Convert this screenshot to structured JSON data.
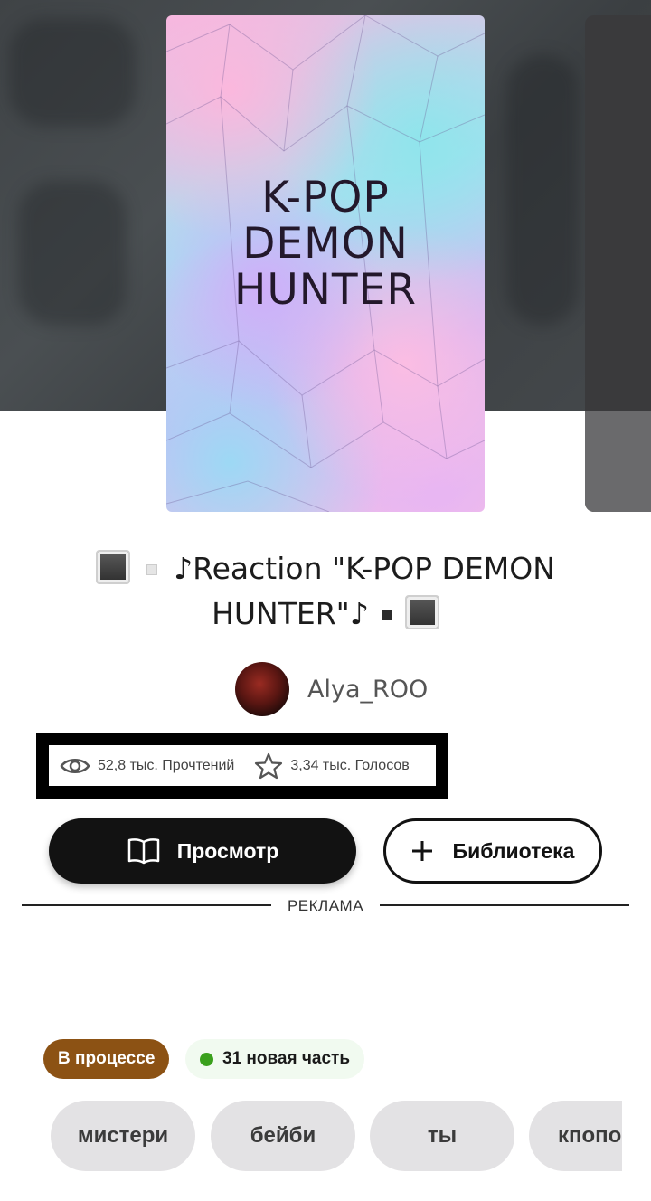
{
  "story": {
    "cover_text": [
      "K-POP",
      "DEMON",
      "HUNTER"
    ],
    "title_line1": "♪Reaction \"K-POP DEMON",
    "title_line2": "HUNTER\"♪"
  },
  "author": {
    "name": "Alya_ROO"
  },
  "stats": {
    "reads": "52,8 тыс. Прочтений",
    "votes": "3,34 тыс. Голосов"
  },
  "actions": {
    "read_label": "Просмотр",
    "library_label": "Библиотека"
  },
  "ad": {
    "label": "РЕКЛАМА"
  },
  "status": {
    "state": "В процессе",
    "new_parts": "31 новая часть"
  },
  "tags": [
    "мистери",
    "бейби",
    "ты",
    "кпопо"
  ],
  "colors": {
    "status_badge": "#8c5214",
    "new_part_dot": "#3aa01c",
    "primary_button": "#121212"
  }
}
